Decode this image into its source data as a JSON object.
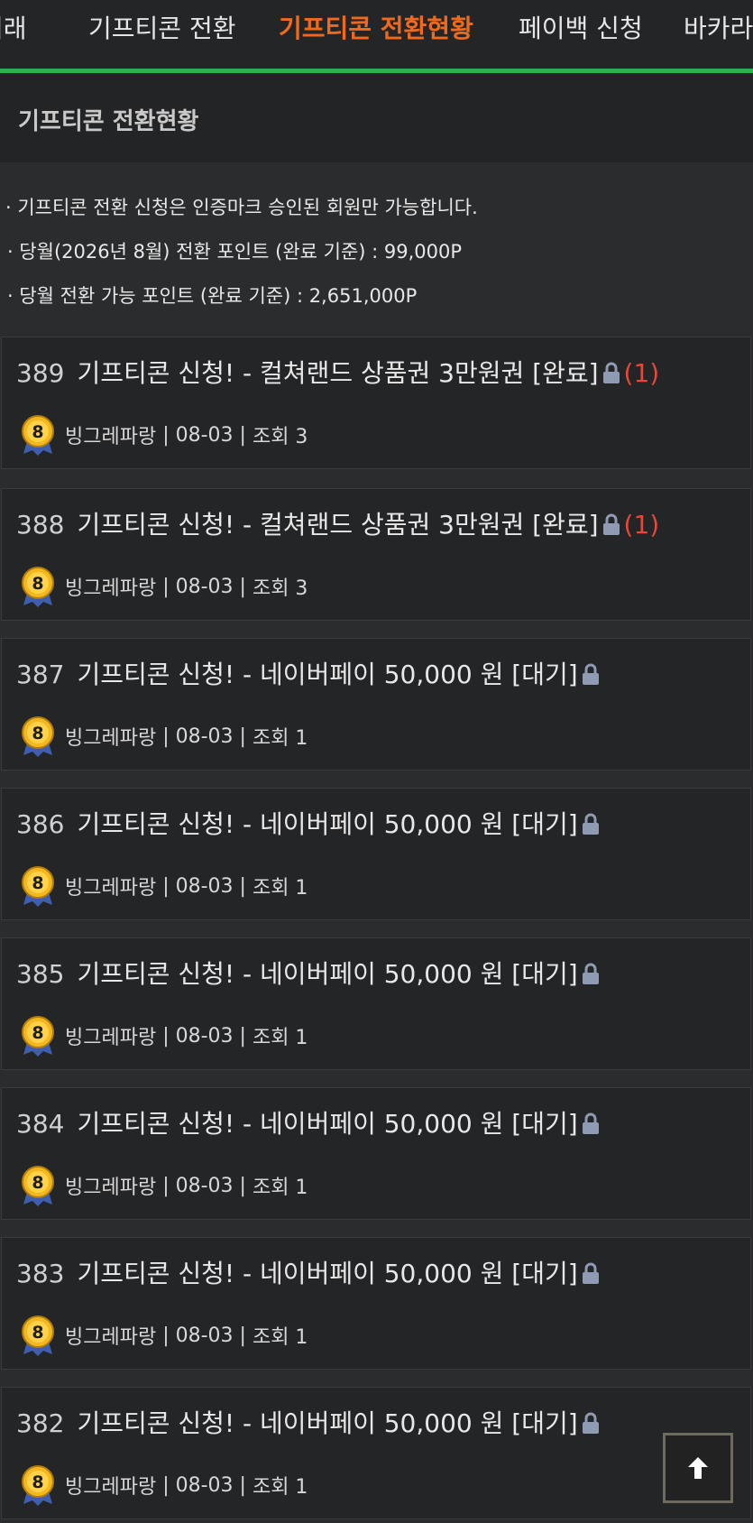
{
  "nav": {
    "tabs": [
      {
        "label": "거래",
        "active": false
      },
      {
        "label": "기프티콘 전환",
        "active": false
      },
      {
        "label": "기프티콘 전환현황",
        "active": true
      },
      {
        "label": "페이백 신청",
        "active": false
      },
      {
        "label": "바카라",
        "active": false
      }
    ]
  },
  "section": {
    "title": "기프티콘 전환현황"
  },
  "notice": {
    "lines": [
      "· 기프티콘 전환 신청은 인증마크 승인된 회원만 가능합니다.",
      "·  당월(2026년 8월) 전환 포인트 (완료 기준) : 99,000P",
      "·  당월 전환 가능 포인트 (완료 기준) : 2,651,000P"
    ]
  },
  "posts": [
    {
      "num": "389",
      "title": "기프티콘 신청! - 컬쳐랜드 상품권 3만원권 [완료]",
      "locked": true,
      "count": "(1)",
      "author": "빙그레파랑",
      "date": "08-03",
      "views": "조회 3",
      "badge": "8"
    },
    {
      "num": "388",
      "title": "기프티콘 신청! - 컬쳐랜드 상품권 3만원권 [완료]",
      "locked": true,
      "count": "(1)",
      "author": "빙그레파랑",
      "date": "08-03",
      "views": "조회 3",
      "badge": "8"
    },
    {
      "num": "387",
      "title": "기프티콘 신청! - 네이버페이 50,000 원 [대기]",
      "locked": true,
      "count": "",
      "author": "빙그레파랑",
      "date": "08-03",
      "views": "조회 1",
      "badge": "8"
    },
    {
      "num": "386",
      "title": "기프티콘 신청! - 네이버페이 50,000 원 [대기]",
      "locked": true,
      "count": "",
      "author": "빙그레파랑",
      "date": "08-03",
      "views": "조회 1",
      "badge": "8"
    },
    {
      "num": "385",
      "title": "기프티콘 신청! - 네이버페이 50,000 원 [대기]",
      "locked": true,
      "count": "",
      "author": "빙그레파랑",
      "date": "08-03",
      "views": "조회 1",
      "badge": "8"
    },
    {
      "num": "384",
      "title": "기프티콘 신청! - 네이버페이 50,000 원 [대기]",
      "locked": true,
      "count": "",
      "author": "빙그레파랑",
      "date": "08-03",
      "views": "조회 1",
      "badge": "8"
    },
    {
      "num": "383",
      "title": "기프티콘 신청! - 네이버페이 50,000 원 [대기]",
      "locked": true,
      "count": "",
      "author": "빙그레파랑",
      "date": "08-03",
      "views": "조회 1",
      "badge": "8"
    },
    {
      "num": "382",
      "title": "기프티콘 신청! - 네이버페이 50,000 원 [대기]",
      "locked": true,
      "count": "",
      "author": "빙그레파랑",
      "date": "08-03",
      "views": "조회 1",
      "badge": "8"
    }
  ],
  "colors": {
    "accent_green": "#2fb24d",
    "active_tab": "#f06a1d",
    "comment_count": "#e5483b",
    "lock_icon": "#8e9bb3"
  }
}
